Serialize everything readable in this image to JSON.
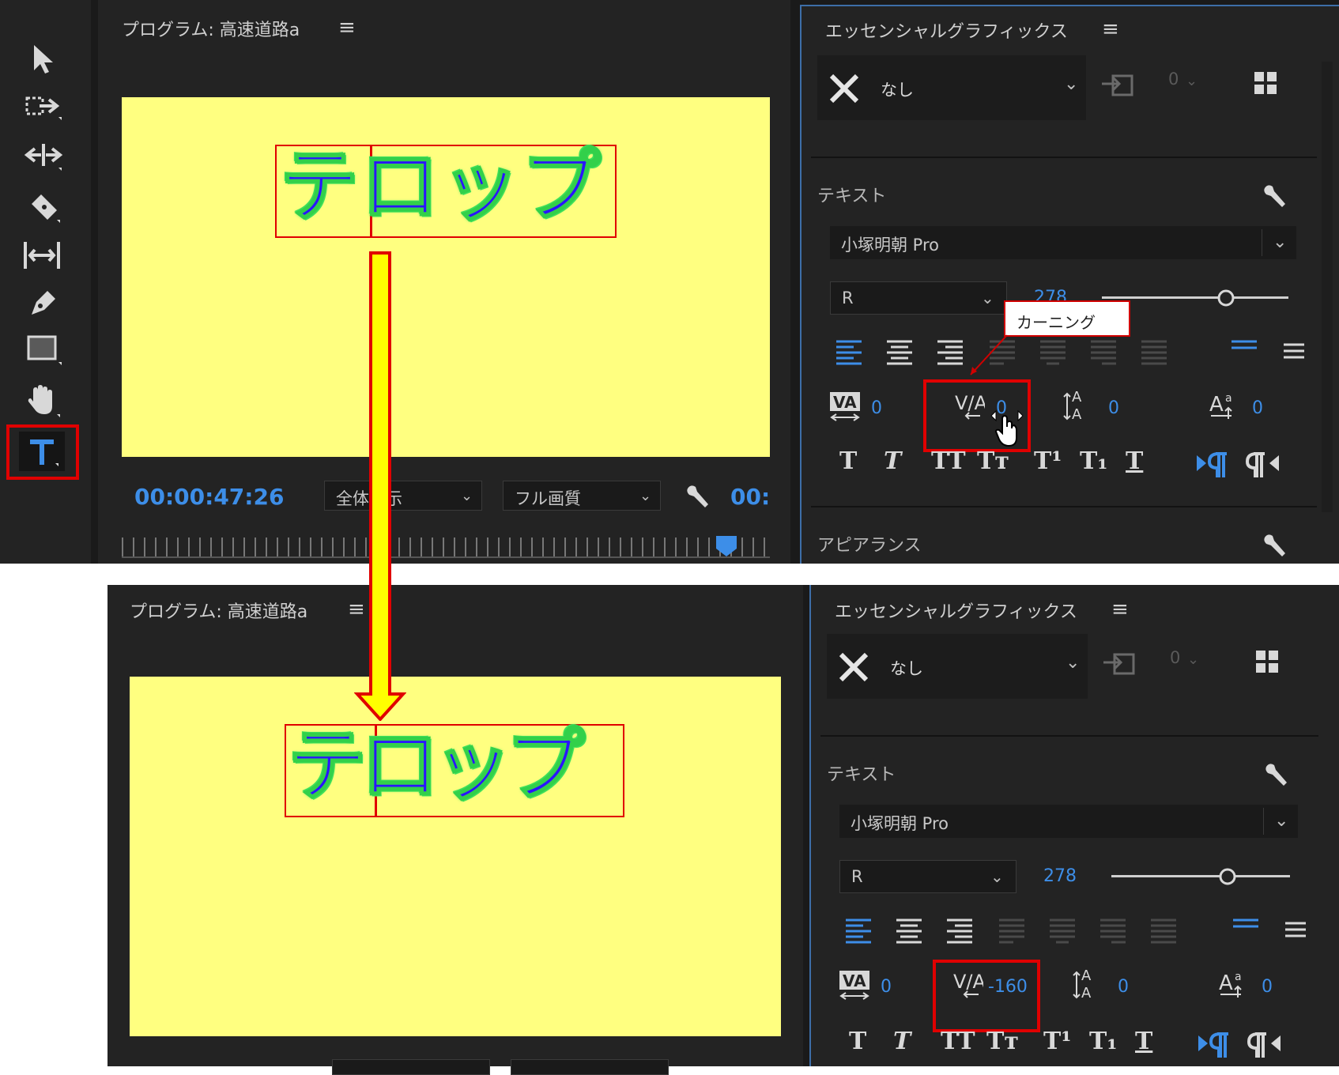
{
  "top": {
    "toolbar": {
      "tools": [
        "selection-tool",
        "track-select-tool",
        "ripple-edit-tool",
        "razor-tool",
        "slip-tool",
        "pen-tool",
        "rectangle-tool",
        "hand-tool",
        "type-tool"
      ]
    },
    "program": {
      "title": "プログラム: 高速道路a",
      "telop": "テロップ",
      "timecode": "00:00:47:26",
      "fit_select": "全体表示",
      "quality_select": "フル画質",
      "timecode_right": "00:"
    },
    "eg": {
      "title": "エッセンシャルグラフィックス",
      "style_select": "なし",
      "style_count": "0",
      "text_section": "テキスト",
      "font_family": "小塚明朝 Pro",
      "font_style": "R",
      "font_size": "278",
      "tracking_value": "0",
      "kerning_value": "0",
      "leading_value": "0",
      "baseline_value": "0",
      "appearance_section": "アピアランス",
      "callout": "カーニング"
    }
  },
  "bottom": {
    "program": {
      "title": "プログラム: 高速道路a",
      "telop": "テロップ"
    },
    "eg": {
      "title": "エッセンシャルグラフィックス",
      "style_select": "なし",
      "style_count": "0",
      "text_section": "テキスト",
      "font_family": "小塚明朝 Pro",
      "font_style": "R",
      "font_size": "278",
      "tracking_value": "0",
      "kerning_value": "-160",
      "leading_value": "0",
      "baseline_value": "0"
    }
  },
  "format_buttons": [
    "T",
    "T",
    "TT",
    "Tт",
    "T¹",
    "T₁",
    "T"
  ],
  "colors": {
    "accent": "#3d8ee8",
    "highlight": "#e00000",
    "frame": "#ffff80",
    "arrow": "#ffff00"
  }
}
